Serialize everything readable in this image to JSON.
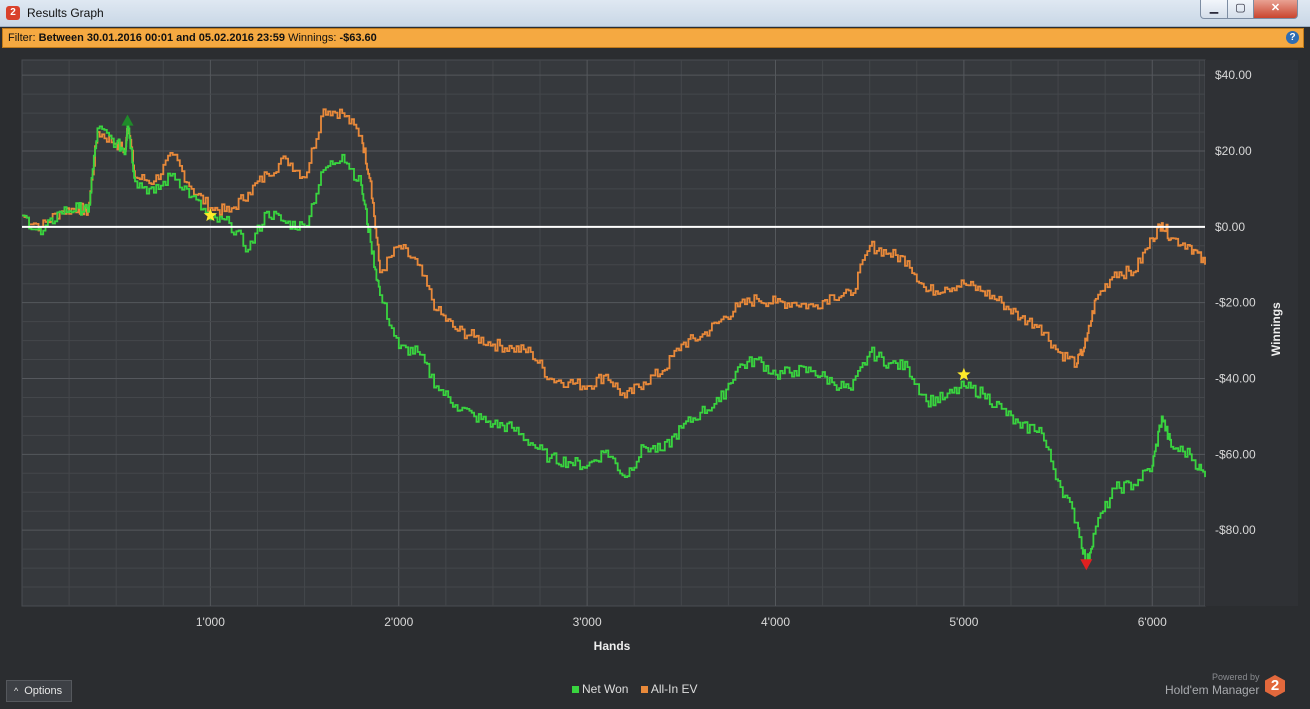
{
  "window": {
    "title": "Results Graph",
    "app_icon": "2",
    "min_label": "▁",
    "max_label": "▢",
    "close_label": "✕"
  },
  "filter": {
    "label": "Filter:",
    "range_text": "Between 30.01.2016 00:01 and 05.02.2016 23:59",
    "winnings_label": "Winnings:",
    "winnings_value": "-$63.60",
    "help": "?"
  },
  "options_label": "Options",
  "powered_by": "Powered by",
  "brand_name": "Hold'em Manager",
  "brand_logo": "2",
  "colors": {
    "net_won": "#39d43f",
    "all_in_ev": "#e8893a",
    "zero_line": "#ffffff",
    "max_marker": "#1f8a2a",
    "min_marker": "#e02020",
    "star": "#ffeb2a"
  },
  "chart_data": {
    "type": "line",
    "xlabel": "Hands",
    "ylabel": "Winnings",
    "xlim": [
      0,
      6280
    ],
    "ylim": [
      -100,
      44
    ],
    "x_ticks": [
      1000,
      2000,
      3000,
      4000,
      5000,
      6000
    ],
    "x_tick_labels": [
      "1'000",
      "2'000",
      "3'000",
      "4'000",
      "5'000",
      "6'000"
    ],
    "y_ticks": [
      40,
      20,
      0,
      -20,
      -40,
      -60,
      -80
    ],
    "y_tick_labels": [
      "$40.00",
      "$20.00",
      "$0.00",
      "-$20.00",
      "-$40.00",
      "-$60.00",
      "-$80.00"
    ],
    "grid": true,
    "legend_position": "bottom-center",
    "series": [
      {
        "name": "Net Won",
        "x": [
          0,
          100,
          200,
          300,
          350,
          400,
          500,
          550,
          560,
          600,
          700,
          800,
          900,
          1000,
          1100,
          1200,
          1300,
          1400,
          1500,
          1600,
          1700,
          1800,
          1850,
          1900,
          2000,
          2100,
          2200,
          2300,
          2400,
          2500,
          2600,
          2700,
          2800,
          2900,
          3000,
          3100,
          3200,
          3300,
          3400,
          3500,
          3600,
          3700,
          3800,
          3900,
          4000,
          4100,
          4200,
          4300,
          4400,
          4500,
          4600,
          4700,
          4800,
          4900,
          5000,
          5100,
          5200,
          5300,
          5400,
          5500,
          5600,
          5650,
          5700,
          5800,
          5900,
          6000,
          6050,
          6100,
          6200,
          6280
        ],
        "values": [
          3,
          -2,
          4,
          5,
          4,
          26,
          22,
          20,
          28,
          12,
          9,
          14,
          8,
          2,
          1,
          -6,
          4,
          1,
          0,
          15,
          19,
          11,
          -4,
          -18,
          -32,
          -33,
          -42,
          -47,
          -50,
          -52,
          -53,
          -57,
          -61,
          -62,
          -63,
          -59,
          -66,
          -58,
          -59,
          -53,
          -49,
          -46,
          -37,
          -35,
          -39,
          -38,
          -38,
          -41,
          -43,
          -33,
          -36,
          -37,
          -46,
          -45,
          -42,
          -44,
          -48,
          -53,
          -53,
          -67,
          -78,
          -89,
          -79,
          -69,
          -68,
          -63,
          -50,
          -58,
          -60,
          -66
        ]
      },
      {
        "name": "All-In EV",
        "x": [
          0,
          100,
          200,
          300,
          350,
          400,
          500,
          550,
          560,
          600,
          700,
          800,
          900,
          1000,
          1100,
          1200,
          1300,
          1400,
          1500,
          1600,
          1700,
          1800,
          1850,
          1900,
          2000,
          2100,
          2200,
          2300,
          2400,
          2500,
          2600,
          2700,
          2800,
          2900,
          3000,
          3100,
          3200,
          3300,
          3400,
          3500,
          3600,
          3700,
          3800,
          3900,
          4000,
          4100,
          4200,
          4300,
          4400,
          4500,
          4600,
          4700,
          4800,
          4900,
          5000,
          5100,
          5200,
          5300,
          5400,
          5500,
          5600,
          5650,
          5700,
          5800,
          5900,
          6000,
          6050,
          6100,
          6200,
          6280
        ],
        "values": [
          3,
          0,
          4,
          5,
          4,
          25,
          22,
          20,
          28,
          13,
          12,
          19,
          10,
          5,
          4,
          9,
          14,
          18,
          13,
          31,
          30,
          24,
          12,
          -12,
          -5,
          -10,
          -22,
          -27,
          -29,
          -31,
          -32,
          -33,
          -40,
          -41,
          -42,
          -39,
          -45,
          -41,
          -38,
          -31,
          -29,
          -25,
          -21,
          -19,
          -20,
          -20,
          -21,
          -18,
          -18,
          -5,
          -7,
          -9,
          -17,
          -16,
          -15,
          -17,
          -20,
          -24,
          -26,
          -33,
          -36,
          -30,
          -19,
          -12,
          -12,
          -3,
          1,
          -3,
          -5,
          -10
        ]
      }
    ],
    "annotations": [
      {
        "type": "max",
        "x": 560,
        "y": 28
      },
      {
        "type": "min",
        "x": 5650,
        "y": -89
      },
      {
        "type": "star",
        "x": 1000,
        "y": 3
      },
      {
        "type": "star",
        "x": 5000,
        "y": -39
      }
    ]
  }
}
